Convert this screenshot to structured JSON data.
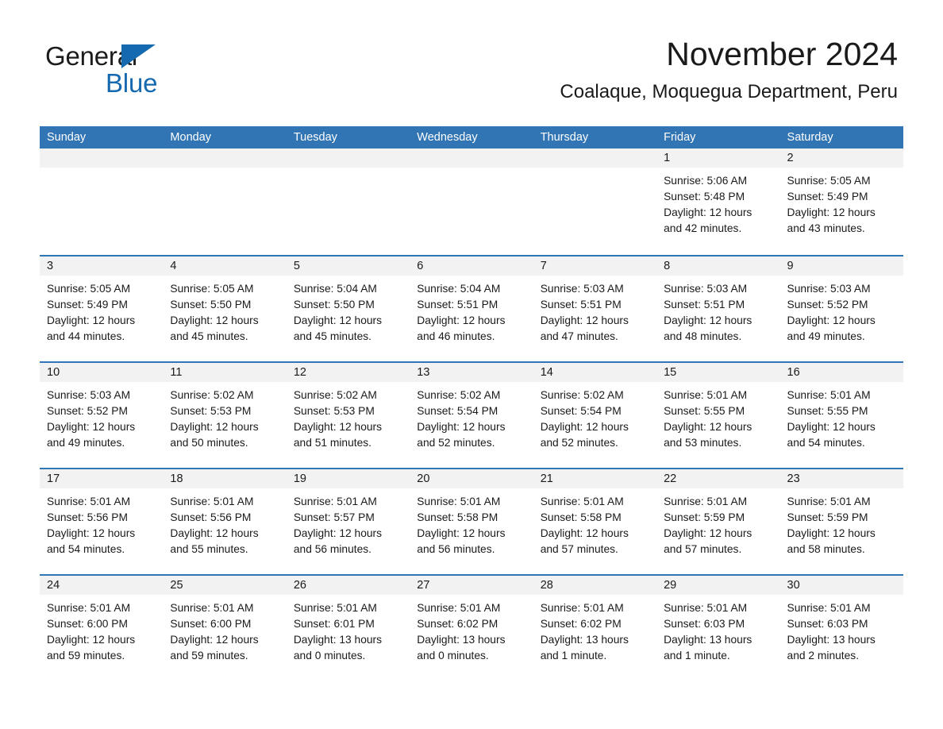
{
  "brand": {
    "word1": "General",
    "word2": "Blue",
    "flag_color": "#1569ae"
  },
  "header": {
    "month_title": "November 2024",
    "location": "Coalaque, Moquegua Department, Peru",
    "accent_color": "#3275b5",
    "band_color": "#f2f2f2"
  },
  "weekday_headers": [
    "Sunday",
    "Monday",
    "Tuesday",
    "Wednesday",
    "Thursday",
    "Friday",
    "Saturday"
  ],
  "weeks": [
    {
      "days": [
        {
          "num": "",
          "lines": []
        },
        {
          "num": "",
          "lines": []
        },
        {
          "num": "",
          "lines": []
        },
        {
          "num": "",
          "lines": []
        },
        {
          "num": "",
          "lines": []
        },
        {
          "num": "1",
          "lines": [
            "Sunrise: 5:06 AM",
            "Sunset: 5:48 PM",
            "Daylight: 12 hours",
            "and 42 minutes."
          ]
        },
        {
          "num": "2",
          "lines": [
            "Sunrise: 5:05 AM",
            "Sunset: 5:49 PM",
            "Daylight: 12 hours",
            "and 43 minutes."
          ]
        }
      ]
    },
    {
      "days": [
        {
          "num": "3",
          "lines": [
            "Sunrise: 5:05 AM",
            "Sunset: 5:49 PM",
            "Daylight: 12 hours",
            "and 44 minutes."
          ]
        },
        {
          "num": "4",
          "lines": [
            "Sunrise: 5:05 AM",
            "Sunset: 5:50 PM",
            "Daylight: 12 hours",
            "and 45 minutes."
          ]
        },
        {
          "num": "5",
          "lines": [
            "Sunrise: 5:04 AM",
            "Sunset: 5:50 PM",
            "Daylight: 12 hours",
            "and 45 minutes."
          ]
        },
        {
          "num": "6",
          "lines": [
            "Sunrise: 5:04 AM",
            "Sunset: 5:51 PM",
            "Daylight: 12 hours",
            "and 46 minutes."
          ]
        },
        {
          "num": "7",
          "lines": [
            "Sunrise: 5:03 AM",
            "Sunset: 5:51 PM",
            "Daylight: 12 hours",
            "and 47 minutes."
          ]
        },
        {
          "num": "8",
          "lines": [
            "Sunrise: 5:03 AM",
            "Sunset: 5:51 PM",
            "Daylight: 12 hours",
            "and 48 minutes."
          ]
        },
        {
          "num": "9",
          "lines": [
            "Sunrise: 5:03 AM",
            "Sunset: 5:52 PM",
            "Daylight: 12 hours",
            "and 49 minutes."
          ]
        }
      ]
    },
    {
      "days": [
        {
          "num": "10",
          "lines": [
            "Sunrise: 5:03 AM",
            "Sunset: 5:52 PM",
            "Daylight: 12 hours",
            "and 49 minutes."
          ]
        },
        {
          "num": "11",
          "lines": [
            "Sunrise: 5:02 AM",
            "Sunset: 5:53 PM",
            "Daylight: 12 hours",
            "and 50 minutes."
          ]
        },
        {
          "num": "12",
          "lines": [
            "Sunrise: 5:02 AM",
            "Sunset: 5:53 PM",
            "Daylight: 12 hours",
            "and 51 minutes."
          ]
        },
        {
          "num": "13",
          "lines": [
            "Sunrise: 5:02 AM",
            "Sunset: 5:54 PM",
            "Daylight: 12 hours",
            "and 52 minutes."
          ]
        },
        {
          "num": "14",
          "lines": [
            "Sunrise: 5:02 AM",
            "Sunset: 5:54 PM",
            "Daylight: 12 hours",
            "and 52 minutes."
          ]
        },
        {
          "num": "15",
          "lines": [
            "Sunrise: 5:01 AM",
            "Sunset: 5:55 PM",
            "Daylight: 12 hours",
            "and 53 minutes."
          ]
        },
        {
          "num": "16",
          "lines": [
            "Sunrise: 5:01 AM",
            "Sunset: 5:55 PM",
            "Daylight: 12 hours",
            "and 54 minutes."
          ]
        }
      ]
    },
    {
      "days": [
        {
          "num": "17",
          "lines": [
            "Sunrise: 5:01 AM",
            "Sunset: 5:56 PM",
            "Daylight: 12 hours",
            "and 54 minutes."
          ]
        },
        {
          "num": "18",
          "lines": [
            "Sunrise: 5:01 AM",
            "Sunset: 5:56 PM",
            "Daylight: 12 hours",
            "and 55 minutes."
          ]
        },
        {
          "num": "19",
          "lines": [
            "Sunrise: 5:01 AM",
            "Sunset: 5:57 PM",
            "Daylight: 12 hours",
            "and 56 minutes."
          ]
        },
        {
          "num": "20",
          "lines": [
            "Sunrise: 5:01 AM",
            "Sunset: 5:58 PM",
            "Daylight: 12 hours",
            "and 56 minutes."
          ]
        },
        {
          "num": "21",
          "lines": [
            "Sunrise: 5:01 AM",
            "Sunset: 5:58 PM",
            "Daylight: 12 hours",
            "and 57 minutes."
          ]
        },
        {
          "num": "22",
          "lines": [
            "Sunrise: 5:01 AM",
            "Sunset: 5:59 PM",
            "Daylight: 12 hours",
            "and 57 minutes."
          ]
        },
        {
          "num": "23",
          "lines": [
            "Sunrise: 5:01 AM",
            "Sunset: 5:59 PM",
            "Daylight: 12 hours",
            "and 58 minutes."
          ]
        }
      ]
    },
    {
      "days": [
        {
          "num": "24",
          "lines": [
            "Sunrise: 5:01 AM",
            "Sunset: 6:00 PM",
            "Daylight: 12 hours",
            "and 59 minutes."
          ]
        },
        {
          "num": "25",
          "lines": [
            "Sunrise: 5:01 AM",
            "Sunset: 6:00 PM",
            "Daylight: 12 hours",
            "and 59 minutes."
          ]
        },
        {
          "num": "26",
          "lines": [
            "Sunrise: 5:01 AM",
            "Sunset: 6:01 PM",
            "Daylight: 13 hours",
            "and 0 minutes."
          ]
        },
        {
          "num": "27",
          "lines": [
            "Sunrise: 5:01 AM",
            "Sunset: 6:02 PM",
            "Daylight: 13 hours",
            "and 0 minutes."
          ]
        },
        {
          "num": "28",
          "lines": [
            "Sunrise: 5:01 AM",
            "Sunset: 6:02 PM",
            "Daylight: 13 hours",
            "and 1 minute."
          ]
        },
        {
          "num": "29",
          "lines": [
            "Sunrise: 5:01 AM",
            "Sunset: 6:03 PM",
            "Daylight: 13 hours",
            "and 1 minute."
          ]
        },
        {
          "num": "30",
          "lines": [
            "Sunrise: 5:01 AM",
            "Sunset: 6:03 PM",
            "Daylight: 13 hours",
            "and 2 minutes."
          ]
        }
      ]
    }
  ]
}
